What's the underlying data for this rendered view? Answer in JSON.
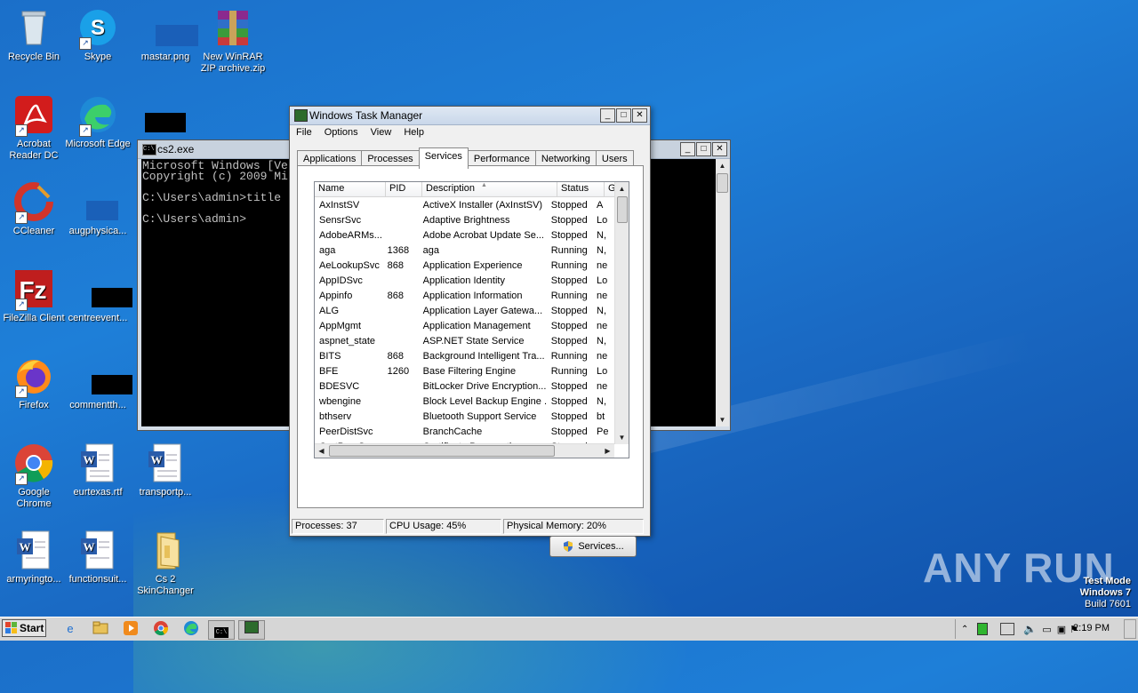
{
  "desktop": {
    "icons": [
      {
        "label": "Recycle Bin"
      },
      {
        "label": "Skype"
      },
      {
        "label": "mastar.png"
      },
      {
        "label": "New WinRAR ZIP archive.zip"
      },
      {
        "label": "Acrobat Reader DC"
      },
      {
        "label": "Microsoft Edge"
      },
      {
        "label": "CCleaner"
      },
      {
        "label": "augphysica..."
      },
      {
        "label": "FileZilla Client"
      },
      {
        "label": "centreevent..."
      },
      {
        "label": "Firefox"
      },
      {
        "label": "commentth..."
      },
      {
        "label": "Google Chrome"
      },
      {
        "label": "eurtexas.rtf"
      },
      {
        "label": "transportp..."
      },
      {
        "label": "armyringto..."
      },
      {
        "label": "functionsuit..."
      },
      {
        "label": "Cs 2 SkinChanger"
      }
    ]
  },
  "cmd": {
    "title": "cs2.exe",
    "lines": "Microsoft Windows [Ve\nCopyright (c) 2009 Mi\n\nC:\\Users\\admin>title\n\nC:\\Users\\admin>"
  },
  "taskmgr": {
    "title": "Windows Task Manager",
    "menu": [
      "File",
      "Options",
      "View",
      "Help"
    ],
    "tabs": [
      "Applications",
      "Processes",
      "Services",
      "Performance",
      "Networking",
      "Users"
    ],
    "active_tab": "Services",
    "columns": [
      "Name",
      "PID",
      "Description",
      "Status",
      "G"
    ],
    "rows": [
      {
        "name": "AxInstSV",
        "pid": "",
        "desc": "ActiveX Installer (AxInstSV)",
        "status": "Stopped",
        "group": "A"
      },
      {
        "name": "SensrSvc",
        "pid": "",
        "desc": "Adaptive Brightness",
        "status": "Stopped",
        "group": "Lo"
      },
      {
        "name": "AdobeARMs...",
        "pid": "",
        "desc": "Adobe Acrobat Update Se...",
        "status": "Stopped",
        "group": "N,"
      },
      {
        "name": "aga",
        "pid": "1368",
        "desc": "aga",
        "status": "Running",
        "group": "N,"
      },
      {
        "name": "AeLookupSvc",
        "pid": "868",
        "desc": "Application Experience",
        "status": "Running",
        "group": "ne"
      },
      {
        "name": "AppIDSvc",
        "pid": "",
        "desc": "Application Identity",
        "status": "Stopped",
        "group": "Lo"
      },
      {
        "name": "Appinfo",
        "pid": "868",
        "desc": "Application Information",
        "status": "Running",
        "group": "ne"
      },
      {
        "name": "ALG",
        "pid": "",
        "desc": "Application Layer Gatewa...",
        "status": "Stopped",
        "group": "N,"
      },
      {
        "name": "AppMgmt",
        "pid": "",
        "desc": "Application Management",
        "status": "Stopped",
        "group": "ne"
      },
      {
        "name": "aspnet_state",
        "pid": "",
        "desc": "ASP.NET State Service",
        "status": "Stopped",
        "group": "N,"
      },
      {
        "name": "BITS",
        "pid": "868",
        "desc": "Background Intelligent Tra...",
        "status": "Running",
        "group": "ne"
      },
      {
        "name": "BFE",
        "pid": "1260",
        "desc": "Base Filtering Engine",
        "status": "Running",
        "group": "Lo"
      },
      {
        "name": "BDESVC",
        "pid": "",
        "desc": "BitLocker Drive Encryption...",
        "status": "Stopped",
        "group": "ne"
      },
      {
        "name": "wbengine",
        "pid": "",
        "desc": "Block Level Backup Engine ...",
        "status": "Stopped",
        "group": "N,"
      },
      {
        "name": "bthserv",
        "pid": "",
        "desc": "Bluetooth Support Service",
        "status": "Stopped",
        "group": "bt"
      },
      {
        "name": "PeerDistSvc",
        "pid": "",
        "desc": "BranchCache",
        "status": "Stopped",
        "group": "Pe"
      },
      {
        "name": "CertPropSvc",
        "pid": "",
        "desc": "Certificate Propagation",
        "status": "Stopped",
        "group": "ne"
      }
    ],
    "services_button": "Services...",
    "status": {
      "processes": "Processes: 37",
      "cpu": "CPU Usage: 45%",
      "memory": "Physical Memory: 20%"
    }
  },
  "taskbar": {
    "start_label": "Start",
    "clock": "2:19 PM"
  },
  "watermark": {
    "line1": "Test Mode",
    "line2": "Windows 7",
    "line3": "Build 7601",
    "brand": "ANY RUN"
  }
}
